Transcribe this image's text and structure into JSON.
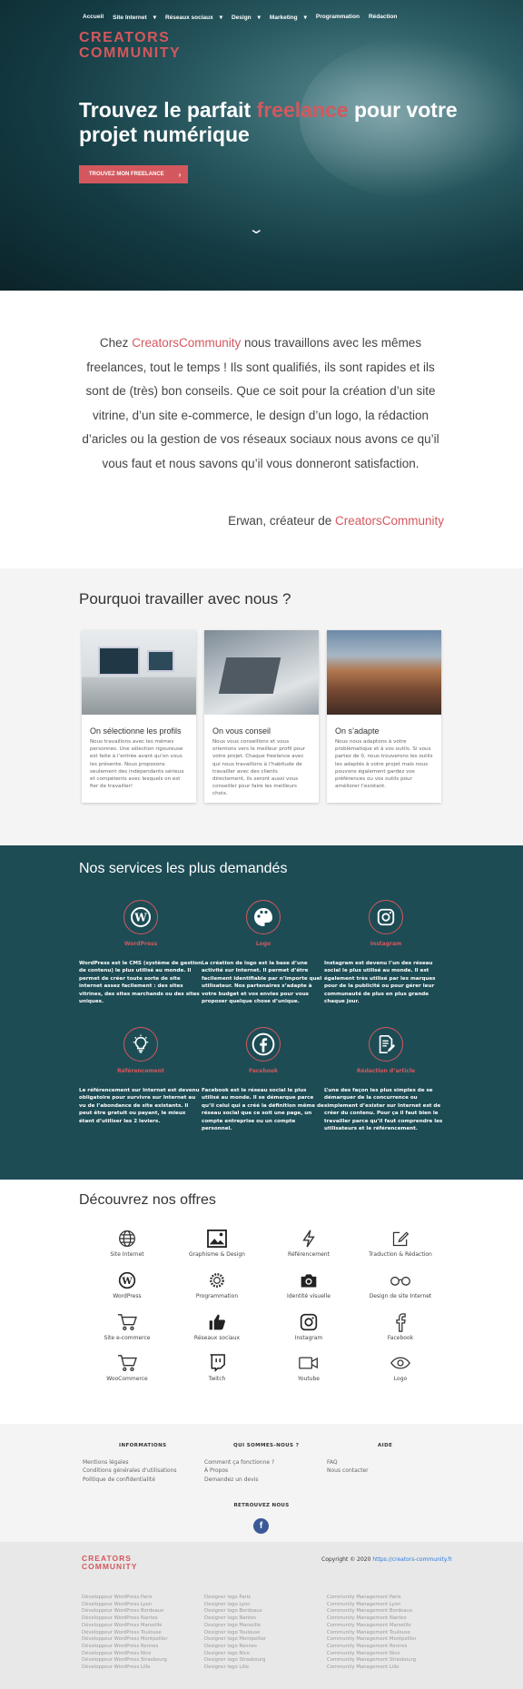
{
  "nav": {
    "items": [
      "Accueil",
      "Site Internet",
      "Réseaux sociaux",
      "Design",
      "Marketing",
      "Programmation",
      "Rédaction"
    ]
  },
  "brand": {
    "line1": "CREATORS",
    "line2": "COMMUNITY"
  },
  "hero": {
    "title_pre": "Trouvez le parfait ",
    "title_hl": "freelance",
    "title_post": " pour votre projet numérique",
    "cta": "TROUVEZ MON FREELANCE"
  },
  "intro": {
    "pre": "Chez ",
    "brand": "CreatorsCommunity",
    "text": " nous travaillons avec les mêmes freelances, tout le temps ! Ils sont qualifiés, ils sont rapides et ils sont de (très) bon conseils. Que ce soit pour la création d’un site vitrine, d’un site e-commerce, le design d’un logo, la rédaction d’aricles ou la gestion de vos réseaux sociaux nous avons ce qu’il vous faut et nous savons qu’il vous donneront satisfaction.",
    "sign_pre": "Erwan, créateur de ",
    "sign_brand": "CreatorsCommunity"
  },
  "why": {
    "title": "Pourquoi travailler avec nous ?",
    "cards": [
      {
        "title": "On sélectionne les profils",
        "text": "Nous travaillons avec les mêmes personnes. Une sélection rigoureuse est faite à l’entrée avant qu’on vous les présente. Nous proposons seulement des indépendants sérieux et compétents avec lesquels on est fier de travailler!"
      },
      {
        "title": "On vous conseil",
        "text": "Nous vous conseillons et vous orientons vers le meilleur profil pour votre projet. Chaque freelance avec qui nous travaillons à l’habitude de travailler avec des clients directement, ils seront aussi vous conseiller pour faire les meilleurs choix."
      },
      {
        "title": "On s’adapte",
        "text": "Nous nous adaptons à votre problématique et à vos outils. Si vous partez de 0, nous trouverons les outils les adaptés à votre projet mais nous pouvons également gardez vos préférences ou vos outils pour améliorer l’existant."
      }
    ]
  },
  "services": {
    "title": "Nos services les plus demandés",
    "items": [
      {
        "name": "WordPress",
        "icon": "wordpress-icon",
        "text": "WordPress est le CMS (système de gestion de contenu) le plus utilisé au monde. Il permet de créer toute sorte de site internet assez facilement : des sites vitrines, des sites marchands ou des sites uniques."
      },
      {
        "name": "Logo",
        "icon": "palette-icon",
        "text": "La création de logo est la base d’une activité sur Internet. Il permet d’être facilement identifiable par n’importe quel utilisateur. Nos partenaires s’adapte à votre budget et vos envies pour vous proposer quelque chose d’unique."
      },
      {
        "name": "Instagram",
        "icon": "instagram-icon",
        "text": "Instagram est devenu l’un des réseau social le plus utilisé au monde. Il est également très utilisé par les marques pour de la publicité ou pour gérer leur communauté de plus en plus grande chaque jour."
      },
      {
        "name": "Référencement",
        "icon": "lightbulb-icon",
        "text": "Le référencement sur Internet est devenu obligatoire pour survivre sur Internet au vu de l’abondance de site existants. Il peut être gratuit ou payant, le mieux étant d’utiliser les 2 leviers."
      },
      {
        "name": "Facebook",
        "icon": "facebook-icon",
        "text": "Facebook est le réseau social le plus utilisé au monde. Il se démarque parce qu’il celui qui a créé la définition même de réseau social que ce soit une page, un compte entreprise ou un compte personnel."
      },
      {
        "name": "Rédaction d’article",
        "icon": "document-edit-icon",
        "text": "L’une des façon les plus simples de se démarquer de la concurrence ou simplement d’exister sur Internet est de créer du contenu. Pour ça il faut bien le travailler parce qu’il faut comprendre les utilisateurs et le référencement."
      }
    ]
  },
  "offers": {
    "title": "Découvrez nos offres",
    "items": [
      {
        "label": "Site Internet",
        "icon": "globe-icon"
      },
      {
        "label": "Graphisme & Design",
        "icon": "image-icon"
      },
      {
        "label": "Référencement",
        "icon": "lightning-icon"
      },
      {
        "label": "Traduction & Rédaction",
        "icon": "pen-square-icon"
      },
      {
        "label": "WordPress",
        "icon": "wordpress-icon"
      },
      {
        "label": "Programmation",
        "icon": "cog-icon"
      },
      {
        "label": "Identité visuelle",
        "icon": "camera-icon"
      },
      {
        "label": "Design de site Internet",
        "icon": "glasses-icon"
      },
      {
        "label": "Site e-commerce",
        "icon": "cart-icon"
      },
      {
        "label": "Réseaux sociaux",
        "icon": "thumbs-up-icon"
      },
      {
        "label": "Instagram",
        "icon": "instagram-icon"
      },
      {
        "label": "Facebook",
        "icon": "facebook-icon"
      },
      {
        "label": "WooCommerce",
        "icon": "cart-icon"
      },
      {
        "label": "Twitch",
        "icon": "twitch-icon"
      },
      {
        "label": "Youtube",
        "icon": "video-icon"
      },
      {
        "label": "Logo",
        "icon": "eye-icon"
      }
    ]
  },
  "footer": {
    "cols": [
      {
        "title": "INFORMATIONS",
        "links": [
          "Mentions légales",
          "Conditions générales d’utilisations",
          "Politique de confidentialité"
        ]
      },
      {
        "title": "QUI SOMMES-NOUS ?",
        "links": [
          "Comment ça fonctionne ?",
          "À Propos",
          "Demandez un devis"
        ]
      },
      {
        "title": "AIDE",
        "links": [
          "FAQ",
          "Nous contacter"
        ]
      }
    ],
    "follow": "RETROUVEZ NOUS",
    "fb_letter": "f"
  },
  "bottom": {
    "copyright": "Copyright © 2020 ",
    "copyright_link": "https://creators-community.fr",
    "lists": [
      [
        "Développeur WordPress Paris",
        "Développeur WordPress Lyon",
        "Développeur WordPress Bordeaux",
        "Développeur WordPress Nantes",
        "Développeur WordPress Marseille",
        "Développeur WordPress Toulouse",
        "Développeur WordPress Montpellier",
        "Développeur WordPress Rennes",
        "Développeur WordPress Nice",
        "Développeur WordPress Strasbourg",
        "Développeur WordPress Lille"
      ],
      [
        "Designer logo Paris",
        "Designer logo Lyon",
        "Designer logo Bordeaux",
        "Designer logo Nantes",
        "Designer logo Marseille",
        "Designer logo Toulouse",
        "Designer logo Montpellier",
        "Designer logo Rennes",
        "Designer logo Nice",
        "Designer logo Strasbourg",
        "Designer logo Lille"
      ],
      [
        "Community Management Paris",
        "Community Management Lyon",
        "Community Management Bordeaux",
        "Community Management Nantes",
        "Community Management Marseille",
        "Community Management Toulouse",
        "Community Management Montpellier",
        "Community Management Rennes",
        "Community Management Nice",
        "Community Management Strasbourg",
        "Community Management Lille"
      ]
    ]
  },
  "colors": {
    "accent": "#d3585d",
    "teal": "#1d4c55"
  }
}
